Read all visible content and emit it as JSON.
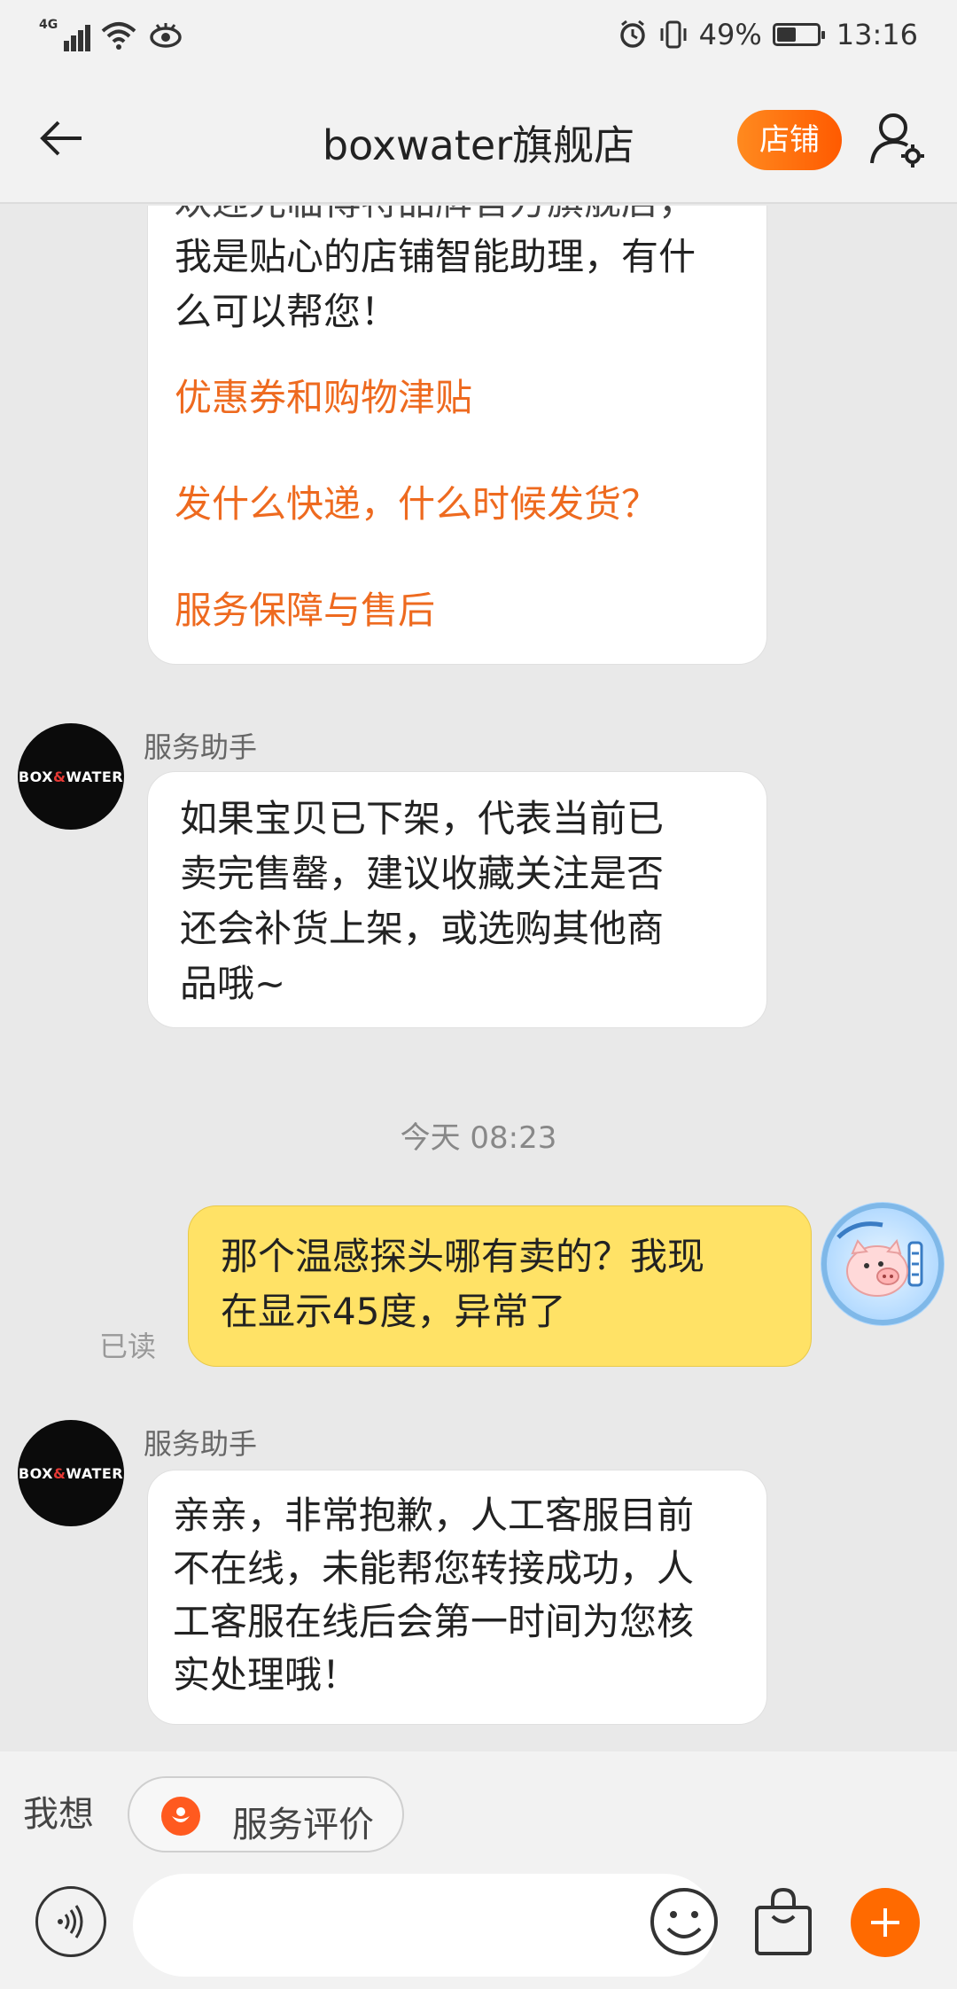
{
  "status_bar": {
    "network": "4G",
    "battery": "49%",
    "time": "13:16"
  },
  "header": {
    "title": "boxwater旗舰店",
    "shop_button": "店铺"
  },
  "messages": {
    "first_bubble": {
      "cut_line": "欢迎光临博特品牌官方旗舰店，",
      "line1": "我是贴心的店铺智能助理，有什",
      "line2": "么可以帮您！",
      "links": [
        "优惠券和购物津贴",
        "发什么快递，什么时候发货？",
        "服务保障与售后"
      ]
    },
    "bot_message_1": {
      "sender": "服务助手",
      "avatar_logo": {
        "left": "BOX",
        "amp": "&",
        "right": "WATER"
      },
      "lines": [
        "如果宝贝已下架，代表当前已",
        "卖完售罄，建议收藏关注是否",
        "还会补货上架，或选购其他商",
        "品哦~"
      ]
    },
    "timestamp": "今天  08:23",
    "user_message": {
      "lines": [
        "那个温感探头哪有卖的？我现",
        "在显示45度，异常了"
      ],
      "read_status": "已读"
    },
    "bot_message_2": {
      "sender": "服务助手",
      "avatar_logo": {
        "left": "BOX",
        "amp": "&",
        "right": "WATER"
      },
      "lines": [
        "亲亲，非常抱歉，人工客服目前",
        "不在线，未能帮您转接成功，人",
        "工客服在线后会第一时间为您核",
        "实处理哦！"
      ]
    }
  },
  "quick_bar": {
    "label": "我想",
    "chip_label": "服务评价"
  },
  "input_bar": {
    "placeholder": ""
  },
  "colors": {
    "accent": "#ff6a00",
    "link": "#ee6a1f",
    "my_bubble": "#ffe266"
  }
}
